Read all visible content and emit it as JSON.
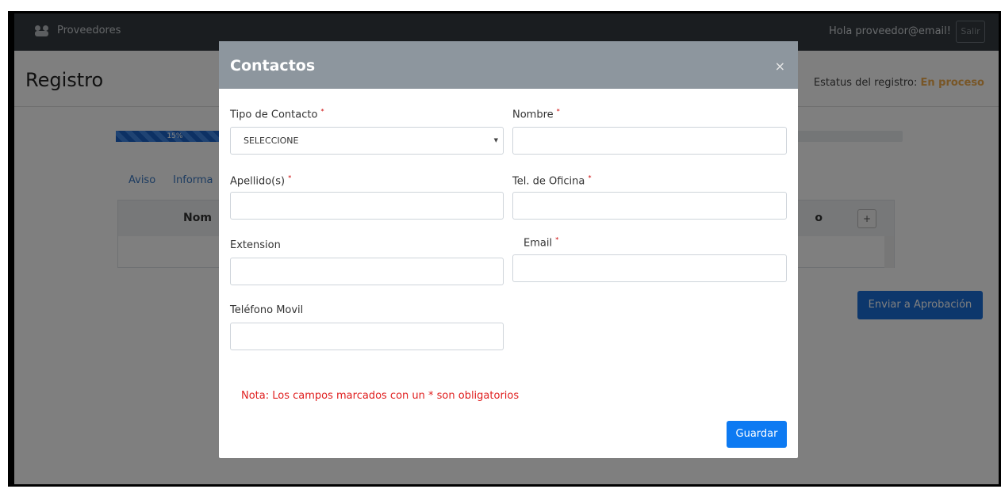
{
  "navbar": {
    "brand_label": "Proveedores",
    "user_greeting": "Hola proveedor@email!",
    "logout_label": "Salir",
    "brand_icon": "users-icon"
  },
  "page": {
    "title": "Registro",
    "status_label": "Estatus del registro:",
    "status_value": "En proceso"
  },
  "progress": {
    "value_percent": 15,
    "label": "15%"
  },
  "background_tabs": [
    "Aviso",
    "Informa"
  ],
  "background_table": {
    "first_header": "Nom",
    "second_header": "o",
    "add_button": "+"
  },
  "send_button": "Enviar a Aprobación",
  "modal": {
    "title": "Contactos",
    "close_symbol": "×",
    "fields": {
      "tipo_contacto": {
        "label": "Tipo de Contacto",
        "required_mark": "*",
        "selected": "SELECCIONE",
        "caret": "▼"
      },
      "nombre": {
        "label": "Nombre",
        "required_mark": "*",
        "value": ""
      },
      "apellidos": {
        "label": "Apellido(s)",
        "required_mark": "*",
        "value": ""
      },
      "tel_oficina": {
        "label": "Tel. de Oficina",
        "required_mark": "*",
        "value": ""
      },
      "extension": {
        "label": "Extension",
        "value": ""
      },
      "email": {
        "label": "Email",
        "required_mark": "*",
        "value": ""
      },
      "telefono_movil": {
        "label": "Teléfono Movil",
        "value": ""
      }
    },
    "note": "Nota: Los campos marcados con un * son obligatorios",
    "save_label": "Guardar"
  },
  "colors": {
    "navbar_bg": "#343a40",
    "modal_header_bg": "#8d969e",
    "primary_button": "#0d7af2",
    "status_value": "#f0ad4e",
    "note_text": "#e02020"
  }
}
